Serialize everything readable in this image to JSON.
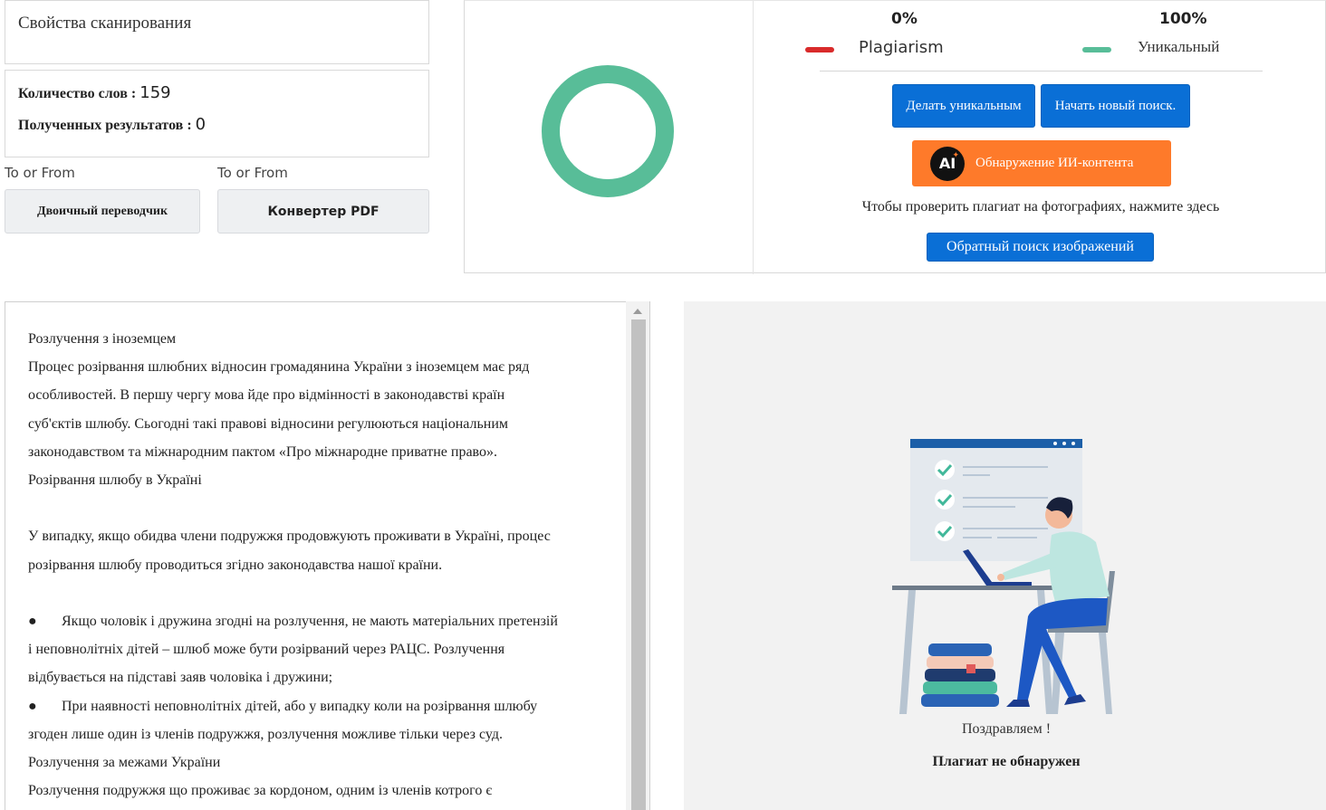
{
  "scan_properties": {
    "title": "Свойства сканирования"
  },
  "stats": {
    "word_count_label": "Количество слов : ",
    "word_count": "159",
    "results_label": "Полученных результатов : ",
    "results_count": "0"
  },
  "tools": [
    {
      "caption": "To or From",
      "button": "Двоичный переводчик"
    },
    {
      "caption": "To or From",
      "button": "Конвертер PDF"
    }
  ],
  "result": {
    "plagiarism_percent": "0%",
    "unique_percent": "100%",
    "plagiarism_label": "Plagiarism",
    "unique_label": "Уникальный",
    "plagiarism_color": "#d92b2b",
    "unique_color": "#58bd98",
    "unique_fraction": 1.0,
    "make_unique_button": "Делать уникальным",
    "new_search_button": "Начать новый поиск.",
    "ai_detect_button": "Обнаружение ИИ-контента",
    "ai_icon_text": "AI",
    "image_hint": "Чтобы проверить плагиат на фотографиях, нажмите здесь",
    "reverse_image_button": "Обратный поиск изображений"
  },
  "editor": {
    "lines": [
      "Розлучення з іноземцем",
      "Процес розірвання шлюбних відносин громадянина України з іноземцем має ряд",
      "особливостей. В першу чергу мова йде про відмінності в законодавстві країн",
      "суб'єктів шлюбу. Сьогодні такі правові відносини регулюються національним",
      "законодавством та міжнародним пактом «Про міжнародне приватне право».",
      "Розірвання шлюбу в Україні",
      "",
      "У випадку, якщо обидва члени подружжя продовжують проживати в Україні, процес",
      "розірвання шлюбу проводиться згідно законодавства нашої країни.",
      "",
      "●\tЯкщо чоловік і дружина згодні на розлучення, не мають матеріальних претензій",
      "і неповнолітніх дітей – шлюб може бути розірваний через РАЦС. Розлучення",
      "відбувається на підставі заяв чоловіка і дружини;",
      "●\tПри наявності неповнолітніх дітей, або у випадку коли на розірвання шлюбу",
      "згоден лише один із членів подружжя, розлучення можливе тільки через суд.",
      "Розлучення за межами України",
      "Розлучення подружжя що проживає за кордоном, одним із членів котрого є"
    ]
  },
  "outcome": {
    "congrats": "Поздравляем !",
    "not_found": "Плагиат не обнаружен"
  }
}
